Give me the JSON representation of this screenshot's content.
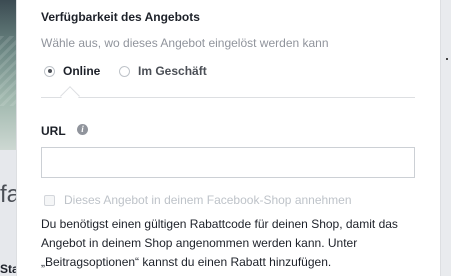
{
  "background": {
    "left_text_1": "fa",
    "left_text_3": "Sta"
  },
  "availability": {
    "title": "Verfügbarkeit des Angebots",
    "description": "Wähle aus, wo dieses Angebot eingelöst werden kann",
    "options": [
      {
        "label": "Online",
        "checked": true
      },
      {
        "label": "Im Geschäft",
        "checked": false
      }
    ]
  },
  "url": {
    "label": "URL",
    "info_icon": "info-icon",
    "value": "",
    "placeholder": ""
  },
  "shop_checkbox": {
    "label": "Dieses Angebot in deinem Facebook-Shop annehmen",
    "checked": false,
    "disabled": true
  },
  "help": {
    "line1": "Du benötigst einen gültigen Rabattcode für deinen Shop, damit das",
    "line2": "Angebot in deinem Shop angenommen werden kann. Unter",
    "line3": "„Beitragsoptionen“ kannst du einen Rabatt hinzufügen."
  }
}
